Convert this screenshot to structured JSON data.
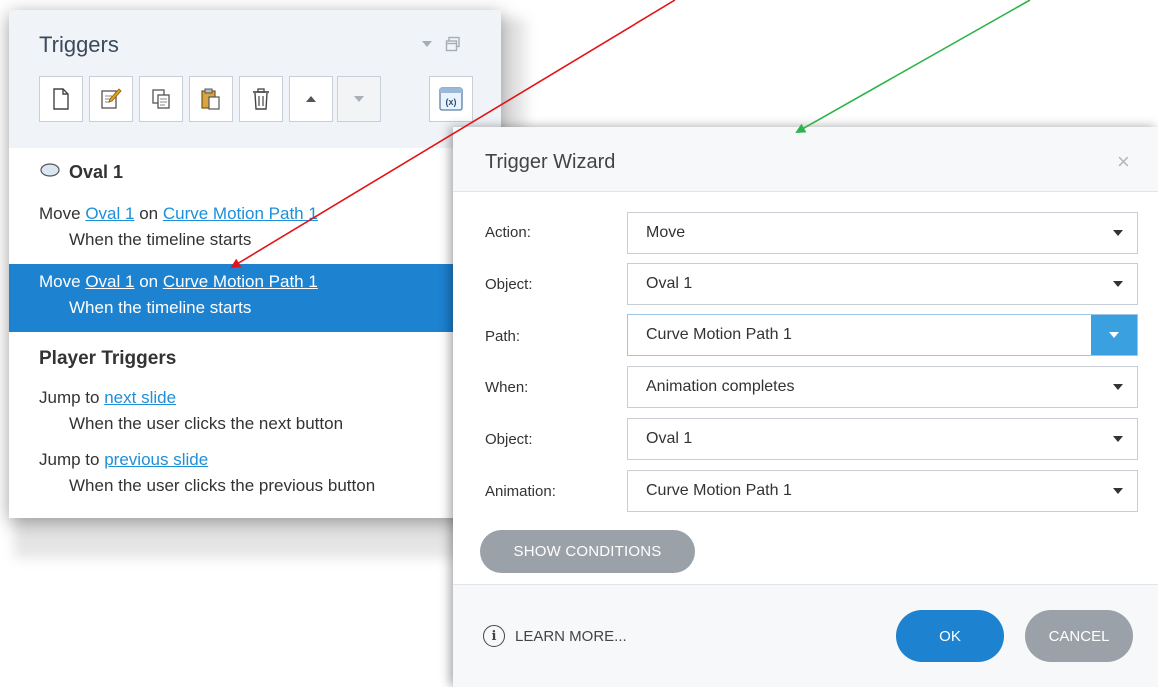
{
  "triggers_panel": {
    "title": "Triggers",
    "toolbar": [
      {
        "icon": "new-trigger-icon"
      },
      {
        "icon": "edit-trigger-icon"
      },
      {
        "icon": "copy-icon"
      },
      {
        "icon": "paste-icon"
      },
      {
        "icon": "delete-icon"
      },
      {
        "icon": "move-up-icon"
      },
      {
        "icon": "move-down-icon"
      },
      {
        "icon": "variables-icon",
        "label": "(x)"
      }
    ],
    "object_section": {
      "label": "Oval 1",
      "icon": "oval-icon"
    },
    "triggers": [
      {
        "action": "Move",
        "object": "Oval 1",
        "on": "on",
        "path": "Curve Motion Path 1",
        "when": "When the timeline starts",
        "selected": false
      },
      {
        "action": "Move",
        "object": "Oval 1",
        "on": "on",
        "path": "Curve Motion Path 1",
        "when": "When the timeline starts",
        "selected": true
      }
    ],
    "player_section": {
      "label": "Player Triggers"
    },
    "player_triggers": [
      {
        "action": "Jump to",
        "target": "next slide",
        "when": "When the user clicks the next button"
      },
      {
        "action": "Jump to",
        "target": "previous slide",
        "when": "When the user clicks the previous button"
      }
    ]
  },
  "wizard": {
    "title": "Trigger Wizard",
    "close": "×",
    "fields": [
      {
        "label": "Action:",
        "value": "Move"
      },
      {
        "label": "Object:",
        "value": "Oval 1"
      },
      {
        "label": "Path:",
        "value": "Curve Motion Path 1",
        "focused": true
      },
      {
        "label": "When:",
        "value": "Animation completes"
      },
      {
        "label": "Object:",
        "value": "Oval 1"
      },
      {
        "label": "Animation:",
        "value": "Curve Motion Path 1"
      }
    ],
    "show_conditions": "SHOW CONDITIONS",
    "learn_more": "LEARN MORE...",
    "info_glyph": "i",
    "ok": "OK",
    "cancel": "CANCEL"
  },
  "colors": {
    "accent": "#1d82d0",
    "link": "#1e8fd8",
    "arrow_red": "#e0151b",
    "arrow_green": "#2db34a"
  }
}
